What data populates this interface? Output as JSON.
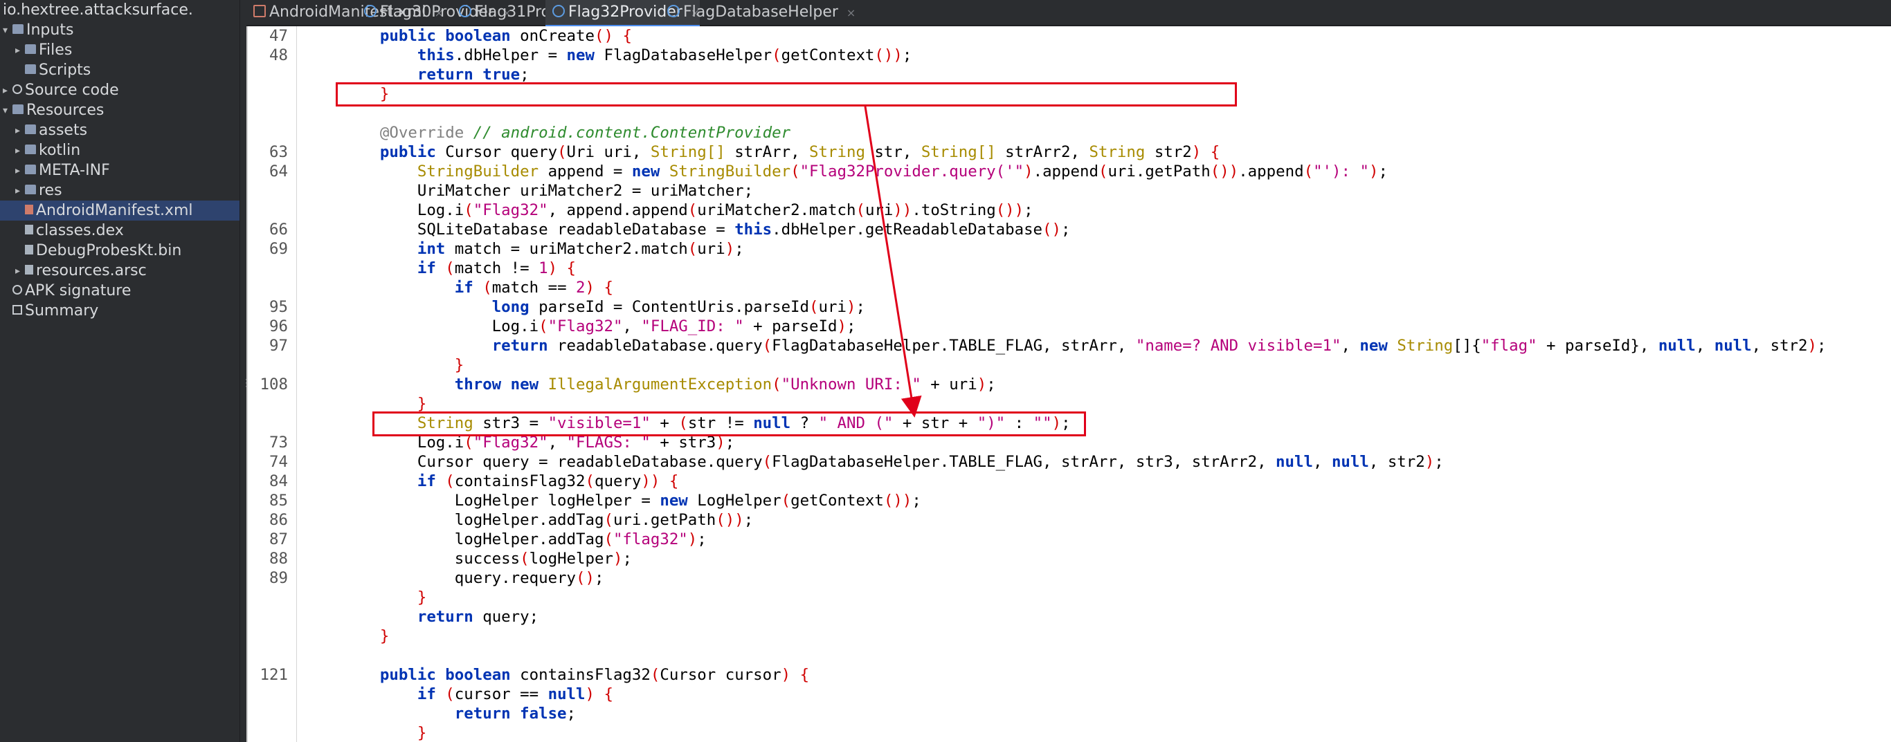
{
  "project": {
    "title": "io.hextree.attacksurface.",
    "tree": [
      {
        "label": "Inputs",
        "icon": "folder-icon",
        "indent": 0,
        "arrow": "down",
        "selected": false
      },
      {
        "label": "Files",
        "icon": "folder-icon",
        "indent": 1,
        "arrow": "right",
        "selected": false
      },
      {
        "label": "Scripts",
        "icon": "folder-icon",
        "indent": 1,
        "arrow": "",
        "selected": false
      },
      {
        "label": "Source code",
        "icon": "gear-icon",
        "indent": 0,
        "arrow": "right",
        "selected": false
      },
      {
        "label": "Resources",
        "icon": "folder-icon",
        "indent": 0,
        "arrow": "down",
        "selected": false
      },
      {
        "label": "assets",
        "icon": "folder-icon",
        "indent": 1,
        "arrow": "right",
        "selected": false
      },
      {
        "label": "kotlin",
        "icon": "folder-icon",
        "indent": 1,
        "arrow": "right",
        "selected": false
      },
      {
        "label": "META-INF",
        "icon": "folder-icon",
        "indent": 1,
        "arrow": "right",
        "selected": false
      },
      {
        "label": "res",
        "icon": "folder-icon",
        "indent": 1,
        "arrow": "right",
        "selected": false
      },
      {
        "label": "AndroidManifest.xml",
        "icon": "xml-file-icon",
        "indent": 1,
        "arrow": "",
        "selected": true
      },
      {
        "label": "classes.dex",
        "icon": "binary-file-icon",
        "indent": 1,
        "arrow": "",
        "selected": false
      },
      {
        "label": "DebugProbesKt.bin",
        "icon": "binary-file-icon",
        "indent": 1,
        "arrow": "",
        "selected": false
      },
      {
        "label": "resources.arsc",
        "icon": "binary-file-icon",
        "indent": 1,
        "arrow": "right",
        "selected": false
      },
      {
        "label": "APK signature",
        "icon": "gear-icon",
        "indent": 0,
        "arrow": "",
        "selected": false
      },
      {
        "label": "Summary",
        "icon": "summary-icon",
        "indent": 0,
        "arrow": "",
        "selected": false
      }
    ]
  },
  "tabs": [
    {
      "label": "AndroidManifest.xml",
      "icon": "xml-file-icon",
      "active": false
    },
    {
      "label": "Flag30Provider",
      "icon": "class-icon",
      "active": false
    },
    {
      "label": "Flag31Provider",
      "icon": "class-icon",
      "active": false
    },
    {
      "label": "Flag32Provider",
      "icon": "class-icon",
      "active": true
    },
    {
      "label": "FlagDatabaseHelper",
      "icon": "class-icon",
      "active": false
    }
  ],
  "code_lines": [
    {
      "ln": "47",
      "tokens": [
        [
          "    ",
          "pl"
        ],
        [
          "public",
          "kw"
        ],
        [
          " ",
          "pl"
        ],
        [
          "boolean",
          "kw"
        ],
        [
          " onCreate",
          "pl"
        ],
        [
          "()",
          "pr"
        ],
        [
          " {",
          "pr"
        ]
      ]
    },
    {
      "ln": "48",
      "tokens": [
        [
          "        ",
          "pl"
        ],
        [
          "this",
          "kw"
        ],
        [
          ".dbHelper = ",
          "pl"
        ],
        [
          "new",
          "kw"
        ],
        [
          " FlagDatabaseHelper",
          "pl"
        ],
        [
          "(",
          "pr"
        ],
        [
          "getContext",
          "pl"
        ],
        [
          "()",
          "pr"
        ],
        [
          ")",
          "pr"
        ],
        [
          ";",
          "pl"
        ]
      ]
    },
    {
      "ln": "",
      "tokens": [
        [
          "        ",
          "pl"
        ],
        [
          "return",
          "kw"
        ],
        [
          " ",
          "pl"
        ],
        [
          "true",
          "kw"
        ],
        [
          ";",
          "pl"
        ]
      ]
    },
    {
      "ln": "",
      "tokens": [
        [
          "    ",
          "pl"
        ],
        [
          "}",
          "pr"
        ]
      ]
    },
    {
      "ln": "",
      "tokens": []
    },
    {
      "ln": "",
      "tokens": [
        [
          "    ",
          "pl"
        ],
        [
          "@Override",
          "an"
        ],
        [
          " // android.content.ContentProvider",
          "cm"
        ]
      ]
    },
    {
      "ln": "63",
      "tokens": [
        [
          "    ",
          "pl"
        ],
        [
          "public",
          "kw"
        ],
        [
          " Cursor query",
          "pl"
        ],
        [
          "(",
          "pr"
        ],
        [
          "Uri uri, ",
          "pl"
        ],
        [
          "String[]",
          "tp"
        ],
        [
          " strArr, ",
          "pl"
        ],
        [
          "String",
          "tp"
        ],
        [
          " str, ",
          "pl"
        ],
        [
          "String[]",
          "tp"
        ],
        [
          " strArr2, ",
          "pl"
        ],
        [
          "String",
          "tp"
        ],
        [
          " str2",
          "pl"
        ],
        [
          ")",
          "pr"
        ],
        [
          " {",
          "pr"
        ]
      ]
    },
    {
      "ln": "64",
      "tokens": [
        [
          "        ",
          "pl"
        ],
        [
          "StringBuilder",
          "tp"
        ],
        [
          " append = ",
          "pl"
        ],
        [
          "new",
          "kw"
        ],
        [
          " ",
          "pl"
        ],
        [
          "StringBuilder",
          "tp"
        ],
        [
          "(",
          "pr"
        ],
        [
          "\"Flag32Provider.query('\"",
          "st"
        ],
        [
          ")",
          "pr"
        ],
        [
          ".append",
          "pl"
        ],
        [
          "(",
          "pr"
        ],
        [
          "uri.getPath",
          "pl"
        ],
        [
          "()",
          "pr"
        ],
        [
          ")",
          "pr"
        ],
        [
          ".append",
          "pl"
        ],
        [
          "(",
          "pr"
        ],
        [
          "\"'): \"",
          "st"
        ],
        [
          ")",
          "pr"
        ],
        [
          ";",
          "pl"
        ]
      ]
    },
    {
      "ln": "",
      "tokens": [
        [
          "        UriMatcher uriMatcher2 = uriMatcher;",
          "pl"
        ]
      ]
    },
    {
      "ln": "",
      "tokens": [
        [
          "        Log.i",
          "pl"
        ],
        [
          "(",
          "pr"
        ],
        [
          "\"Flag32\"",
          "st"
        ],
        [
          ", append.append",
          "pl"
        ],
        [
          "(",
          "pr"
        ],
        [
          "uriMatcher2.match",
          "pl"
        ],
        [
          "(",
          "pr"
        ],
        [
          "uri",
          "pl"
        ],
        [
          ")",
          "pr"
        ],
        [
          ")",
          "pr"
        ],
        [
          ".toString",
          "pl"
        ],
        [
          "()",
          "pr"
        ],
        [
          ")",
          "pr"
        ],
        [
          ";",
          "pl"
        ]
      ]
    },
    {
      "ln": "66",
      "tokens": [
        [
          "        SQLiteDatabase readableDatabase = ",
          "pl"
        ],
        [
          "this",
          "kw"
        ],
        [
          ".dbHelper.getReadableDatabase",
          "pl"
        ],
        [
          "()",
          "pr"
        ],
        [
          ";",
          "pl"
        ]
      ]
    },
    {
      "ln": "69",
      "tokens": [
        [
          "        ",
          "pl"
        ],
        [
          "int",
          "kw"
        ],
        [
          " match = uriMatcher2.match",
          "pl"
        ],
        [
          "(",
          "pr"
        ],
        [
          "uri",
          "pl"
        ],
        [
          ")",
          "pr"
        ],
        [
          ";",
          "pl"
        ]
      ]
    },
    {
      "ln": "",
      "tokens": [
        [
          "        ",
          "pl"
        ],
        [
          "if",
          "kw"
        ],
        [
          " ",
          "pl"
        ],
        [
          "(",
          "pr"
        ],
        [
          "match != ",
          "pl"
        ],
        [
          "1",
          "st"
        ],
        [
          ")",
          "pr"
        ],
        [
          " {",
          "pr"
        ]
      ]
    },
    {
      "ln": "",
      "tokens": [
        [
          "            ",
          "pl"
        ],
        [
          "if",
          "kw"
        ],
        [
          " ",
          "pl"
        ],
        [
          "(",
          "pr"
        ],
        [
          "match == ",
          "pl"
        ],
        [
          "2",
          "st"
        ],
        [
          ")",
          "pr"
        ],
        [
          " {",
          "pr"
        ]
      ]
    },
    {
      "ln": "95",
      "tokens": [
        [
          "                ",
          "pl"
        ],
        [
          "long",
          "kw"
        ],
        [
          " parseId = ContentUris.parseId",
          "pl"
        ],
        [
          "(",
          "pr"
        ],
        [
          "uri",
          "pl"
        ],
        [
          ")",
          "pr"
        ],
        [
          ";",
          "pl"
        ]
      ]
    },
    {
      "ln": "96",
      "tokens": [
        [
          "                Log.i",
          "pl"
        ],
        [
          "(",
          "pr"
        ],
        [
          "\"Flag32\"",
          "st"
        ],
        [
          ", ",
          "pl"
        ],
        [
          "\"FLAG_ID: \"",
          "st"
        ],
        [
          " + parseId",
          "pl"
        ],
        [
          ")",
          "pr"
        ],
        [
          ";",
          "pl"
        ]
      ]
    },
    {
      "ln": "97",
      "tokens": [
        [
          "                ",
          "pl"
        ],
        [
          "return",
          "kw"
        ],
        [
          " readableDatabase.query",
          "pl"
        ],
        [
          "(",
          "pr"
        ],
        [
          "FlagDatabaseHelper.TABLE_FLAG, strArr, ",
          "pl"
        ],
        [
          "\"name=? AND visible=1\"",
          "st"
        ],
        [
          ", ",
          "pl"
        ],
        [
          "new",
          "kw"
        ],
        [
          " ",
          "pl"
        ],
        [
          "String",
          "tp"
        ],
        [
          "[]{",
          "pl"
        ],
        [
          "\"flag\"",
          "st"
        ],
        [
          " + parseId}, ",
          "pl"
        ],
        [
          "null",
          "kw"
        ],
        [
          ", ",
          "pl"
        ],
        [
          "null",
          "kw"
        ],
        [
          ", str2",
          "pl"
        ],
        [
          ")",
          "pr"
        ],
        [
          ";",
          "pl"
        ]
      ]
    },
    {
      "ln": "",
      "tokens": [
        [
          "            ",
          "pl"
        ],
        [
          "}",
          "pr"
        ]
      ]
    },
    {
      "ln": "108",
      "tokens": [
        [
          "            ",
          "pl"
        ],
        [
          "throw",
          "kw"
        ],
        [
          " ",
          "pl"
        ],
        [
          "new",
          "kw"
        ],
        [
          " ",
          "pl"
        ],
        [
          "IllegalArgumentException",
          "tp"
        ],
        [
          "(",
          "pr"
        ],
        [
          "\"Unknown URI: \"",
          "st"
        ],
        [
          " + uri",
          "pl"
        ],
        [
          ")",
          "pr"
        ],
        [
          ";",
          "pl"
        ]
      ]
    },
    {
      "ln": "",
      "tokens": [
        [
          "        ",
          "pl"
        ],
        [
          "}",
          "pr"
        ]
      ]
    },
    {
      "ln": "",
      "tokens": [
        [
          "        ",
          "pl"
        ],
        [
          "String",
          "tp"
        ],
        [
          " str3 = ",
          "pl"
        ],
        [
          "\"visible=1\"",
          "st"
        ],
        [
          " + ",
          "pl"
        ],
        [
          "(",
          "pr"
        ],
        [
          "str != ",
          "pl"
        ],
        [
          "null",
          "kw"
        ],
        [
          " ? ",
          "pl"
        ],
        [
          "\" AND (\"",
          "st"
        ],
        [
          " + str + ",
          "pl"
        ],
        [
          "\")\"",
          "st"
        ],
        [
          " : ",
          "pl"
        ],
        [
          "\"\"",
          "st"
        ],
        [
          ")",
          "pr"
        ],
        [
          ";",
          "pl"
        ]
      ]
    },
    {
      "ln": "73",
      "tokens": [
        [
          "        Log.i",
          "pl"
        ],
        [
          "(",
          "pr"
        ],
        [
          "\"Flag32\"",
          "st"
        ],
        [
          ", ",
          "pl"
        ],
        [
          "\"FLAGS: \"",
          "st"
        ],
        [
          " + str3",
          "pl"
        ],
        [
          ")",
          "pr"
        ],
        [
          ";",
          "pl"
        ]
      ]
    },
    {
      "ln": "74",
      "tokens": [
        [
          "        Cursor query = readableDatabase.query",
          "pl"
        ],
        [
          "(",
          "pr"
        ],
        [
          "FlagDatabaseHelper.TABLE_FLAG, strArr, str3, strArr2, ",
          "pl"
        ],
        [
          "null",
          "kw"
        ],
        [
          ", ",
          "pl"
        ],
        [
          "null",
          "kw"
        ],
        [
          ", str2",
          "pl"
        ],
        [
          ")",
          "pr"
        ],
        [
          ";",
          "pl"
        ]
      ]
    },
    {
      "ln": "84",
      "tokens": [
        [
          "        ",
          "pl"
        ],
        [
          "if",
          "kw"
        ],
        [
          " ",
          "pl"
        ],
        [
          "(",
          "pr"
        ],
        [
          "containsFlag32",
          "pl"
        ],
        [
          "(",
          "pr"
        ],
        [
          "query",
          "pl"
        ],
        [
          ")",
          "pr"
        ],
        [
          ")",
          "pr"
        ],
        [
          " {",
          "pr"
        ]
      ]
    },
    {
      "ln": "85",
      "tokens": [
        [
          "            LogHelper logHelper = ",
          "pl"
        ],
        [
          "new",
          "kw"
        ],
        [
          " LogHelper",
          "pl"
        ],
        [
          "(",
          "pr"
        ],
        [
          "getContext",
          "pl"
        ],
        [
          "()",
          "pr"
        ],
        [
          ")",
          "pr"
        ],
        [
          ";",
          "pl"
        ]
      ]
    },
    {
      "ln": "86",
      "tokens": [
        [
          "            logHelper.addTag",
          "pl"
        ],
        [
          "(",
          "pr"
        ],
        [
          "uri.getPath",
          "pl"
        ],
        [
          "()",
          "pr"
        ],
        [
          ")",
          "pr"
        ],
        [
          ";",
          "pl"
        ]
      ]
    },
    {
      "ln": "87",
      "tokens": [
        [
          "            logHelper.addTag",
          "pl"
        ],
        [
          "(",
          "pr"
        ],
        [
          "\"flag32\"",
          "st"
        ],
        [
          ")",
          "pr"
        ],
        [
          ";",
          "pl"
        ]
      ]
    },
    {
      "ln": "88",
      "tokens": [
        [
          "            success",
          "pl"
        ],
        [
          "(",
          "pr"
        ],
        [
          "logHelper",
          "pl"
        ],
        [
          ")",
          "pr"
        ],
        [
          ";",
          "pl"
        ]
      ]
    },
    {
      "ln": "89",
      "tokens": [
        [
          "            query.requery",
          "pl"
        ],
        [
          "()",
          "pr"
        ],
        [
          ";",
          "pl"
        ]
      ]
    },
    {
      "ln": "",
      "tokens": [
        [
          "        ",
          "pl"
        ],
        [
          "}",
          "pr"
        ]
      ]
    },
    {
      "ln": "",
      "tokens": [
        [
          "        ",
          "pl"
        ],
        [
          "return",
          "kw"
        ],
        [
          " query;",
          "pl"
        ]
      ]
    },
    {
      "ln": "",
      "tokens": [
        [
          "    ",
          "pl"
        ],
        [
          "}",
          "pr"
        ]
      ]
    },
    {
      "ln": "",
      "tokens": []
    },
    {
      "ln": "121",
      "tokens": [
        [
          "    ",
          "pl"
        ],
        [
          "public",
          "kw"
        ],
        [
          " ",
          "pl"
        ],
        [
          "boolean",
          "kw"
        ],
        [
          " containsFlag32",
          "pl"
        ],
        [
          "(",
          "pr"
        ],
        [
          "Cursor cursor",
          "pl"
        ],
        [
          ")",
          "pr"
        ],
        [
          " {",
          "pr"
        ]
      ]
    },
    {
      "ln": "",
      "tokens": [
        [
          "        ",
          "pl"
        ],
        [
          "if",
          "kw"
        ],
        [
          " ",
          "pl"
        ],
        [
          "(",
          "pr"
        ],
        [
          "cursor == ",
          "pl"
        ],
        [
          "null",
          "kw"
        ],
        [
          ")",
          "pr"
        ],
        [
          " {",
          "pr"
        ]
      ]
    },
    {
      "ln": "",
      "tokens": [
        [
          "            ",
          "pl"
        ],
        [
          "return",
          "kw"
        ],
        [
          " ",
          "pl"
        ],
        [
          "false",
          "kw"
        ],
        [
          ";",
          "pl"
        ]
      ]
    },
    {
      "ln": "",
      "tokens": [
        [
          "        ",
          "pl"
        ],
        [
          "}",
          "pr"
        ]
      ]
    }
  ],
  "annotations": {
    "box_color": "#e0001a",
    "highlighted_lines": [
      "63",
      "str3-assignment"
    ]
  },
  "colors": {
    "keyword": "#0033b3",
    "type": "#a78b00",
    "string": "#b5007a",
    "paren": "#d00000",
    "sidebar_bg": "#2b2d30",
    "selected_row": "#2e436e",
    "active_tab_underline": "#4d8ef0"
  }
}
